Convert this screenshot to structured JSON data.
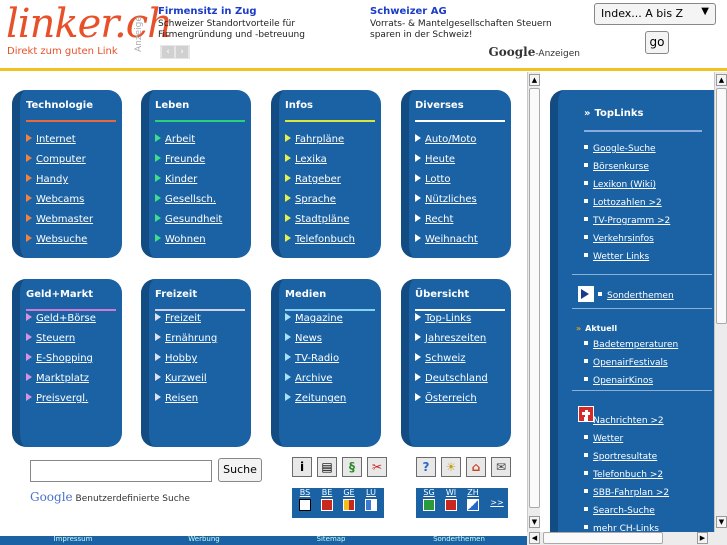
{
  "header": {
    "logo": "linker.ch",
    "slogan": "Direkt zum guten Link",
    "anzeige_label": "Anzeige",
    "ads": [
      {
        "title": "Firmensitz in Zug",
        "text": "Schweizer Standortvorteile für Firmengründung und -betreuung"
      },
      {
        "title": "Schweizer AG",
        "text": "Vorrats- & Mantelgesellschaften Steuern sparen in der Schweiz!"
      }
    ],
    "google_ads_brand": "Google",
    "google_ads_label": "-Anzeigen",
    "index_select": "Index... A bis Z",
    "go_label": "go"
  },
  "categories": [
    {
      "title": "Technologie",
      "rule_color": "#e8693a",
      "marker_color": "#f0813f",
      "links": [
        "Internet",
        "Computer",
        "Handy",
        "Webcams",
        "Webmaster",
        "Websuche"
      ]
    },
    {
      "title": "Leben",
      "rule_color": "#2bd07a",
      "marker_color": "#3de08a",
      "links": [
        "Arbeit",
        "Freunde",
        "Kinder",
        "Gesellsch.",
        "Gesundheit",
        "Wohnen"
      ]
    },
    {
      "title": "Infos",
      "rule_color": "#d8e838",
      "marker_color": "#e6f04a",
      "links": [
        "Fahrpläne",
        "Lexika",
        "Ratgeber",
        "Sprache",
        "Stadtpläne",
        "Telefonbuch"
      ]
    },
    {
      "title": "Diverses",
      "rule_color": "#ffffff",
      "marker_color": "#ffffff",
      "links": [
        "Auto/Moto",
        "Heute",
        "Lotto",
        "Nützliches",
        "Recht",
        "Weihnacht"
      ]
    },
    {
      "title": "Geld+Markt",
      "rule_color": "#d07ad8",
      "marker_color": "#d890e0",
      "links": [
        "Geld+Börse",
        "Steuern",
        "E-Shopping",
        "Marktplatz",
        "Preisvergl."
      ]
    },
    {
      "title": "Freizeit",
      "rule_color": "#d0d0e8",
      "marker_color": "#e0e0f0",
      "links": [
        "Freizeit",
        "Ernährung",
        "Hobby",
        "Kurzweil",
        "Reisen"
      ]
    },
    {
      "title": "Medien",
      "rule_color": "#8ad0f0",
      "marker_color": "#a8e0f8",
      "links": [
        "Magazine",
        "News",
        "TV-Radio",
        "Archive",
        "Zeitungen"
      ]
    },
    {
      "title": "Übersicht",
      "rule_color": "#ffffff",
      "marker_color": "#ffffff",
      "links": [
        "Top-Links",
        "Jahreszeiten",
        "Schweiz",
        "Deutschland",
        "Österreich"
      ]
    }
  ],
  "search": {
    "button": "Suche",
    "google": "Google",
    "custom_label": "Benutzerdefinierte Suche"
  },
  "tools": [
    "i",
    "▤",
    "§",
    "✂"
  ],
  "tools2": [
    "?",
    "☀",
    "⌂",
    "✉"
  ],
  "cantons_left": [
    "BS",
    "BE",
    "GE",
    "LU"
  ],
  "cantons_right": [
    "SG",
    "WI",
    "ZH",
    ">>"
  ],
  "footer_tabs": [
    "Impressum",
    "Werbung",
    "Sitemap",
    "Sonderthemen"
  ],
  "right": {
    "toplinks_title": "TopLinks",
    "toplinks": [
      "Google-Suche",
      "Börsenkurse",
      "Lexikon (Wiki)",
      "Lottozahlen >2",
      "TV-Programm >2",
      "Verkehrsinfos",
      "Wetter Links"
    ],
    "sonderthemen": "Sonderthemen",
    "aktuell_title": "Aktuell",
    "aktuell": [
      "Badetemperaturen",
      "OpenairFestivals",
      "OpenairKinos"
    ],
    "ch_links": [
      "Nachrichten >2",
      "Wetter",
      "Sportresultate",
      "Telefonbuch >2",
      "SBB-Fahrplan >2",
      "Search-Suche",
      "mehr CH-Links"
    ]
  }
}
